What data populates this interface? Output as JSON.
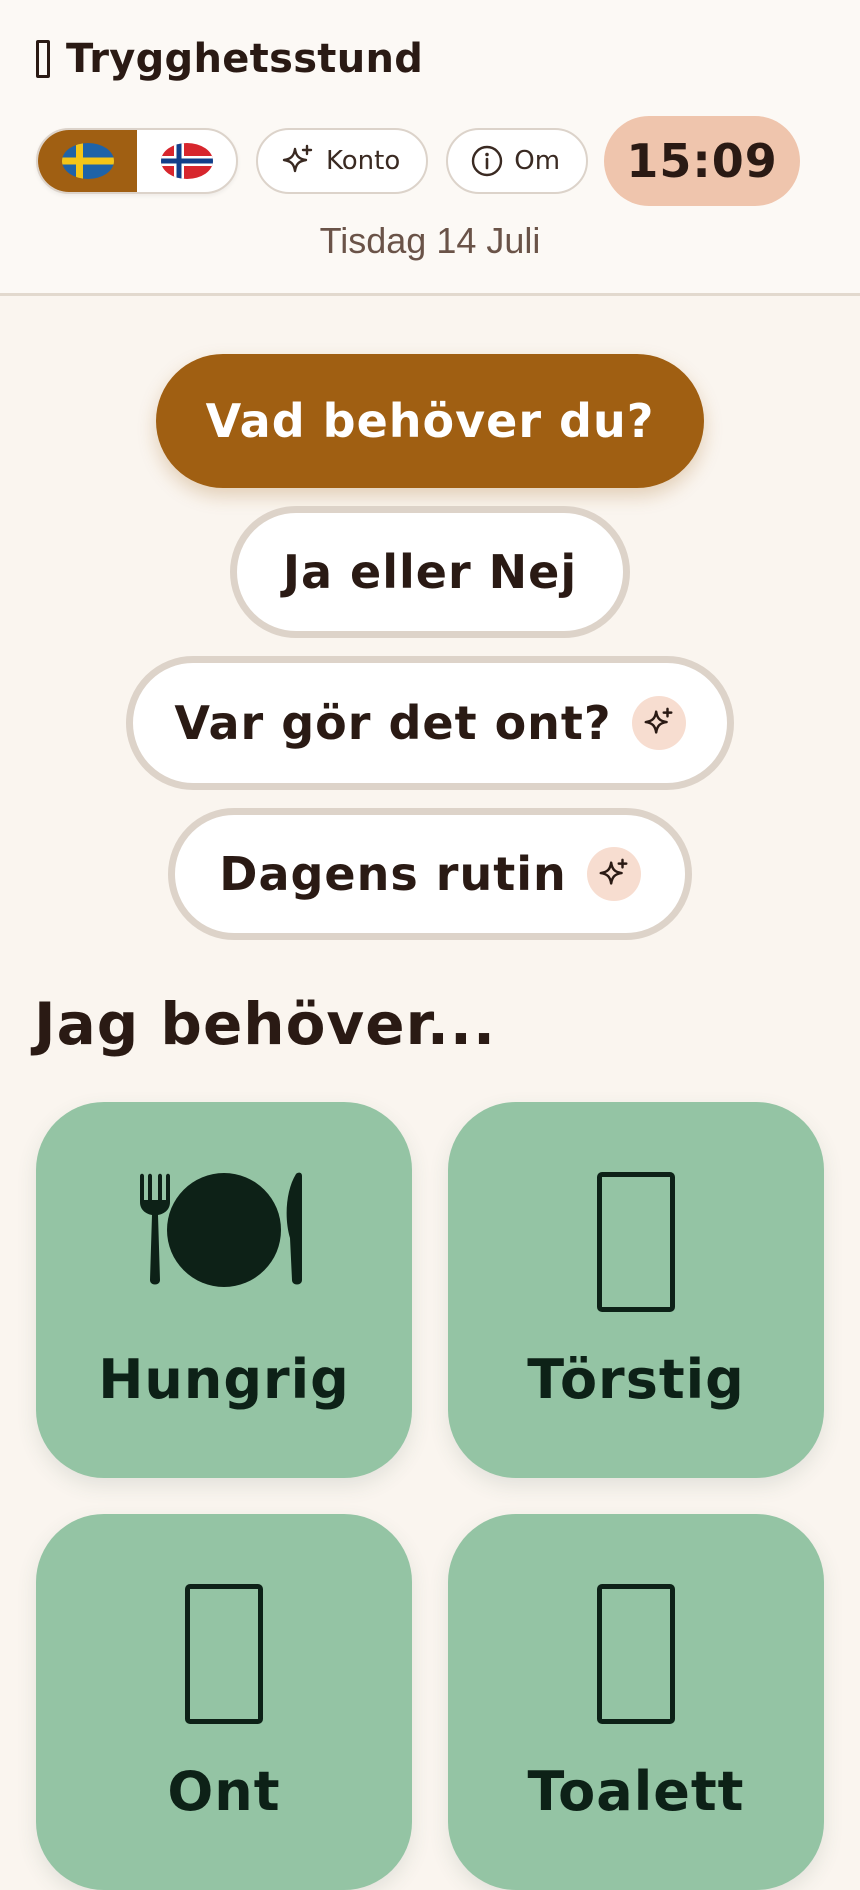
{
  "header": {
    "app_title": "Trygghetsstund",
    "languages": [
      {
        "code": "sv",
        "label": "Svenska",
        "active": true
      },
      {
        "code": "no",
        "label": "Norsk",
        "active": false
      }
    ],
    "account_label": "Konto",
    "about_label": "Om",
    "time": "15:09",
    "date": "Tisdag 14 Juli"
  },
  "main": {
    "primary_button": "Vad behöver du?",
    "buttons": [
      {
        "label": "Ja eller Nej",
        "icon": null
      },
      {
        "label": "Var gör det ont?",
        "icon": "sparkle-icon"
      },
      {
        "label": "Dagens rutin",
        "icon": "sparkle-icon"
      }
    ],
    "section_title": "Jag behöver...",
    "tiles": [
      {
        "label": "Hungrig",
        "icon": "plate-cutlery-icon"
      },
      {
        "label": "Törstig",
        "icon": "drink-icon"
      },
      {
        "label": "Ont",
        "icon": "pain-icon"
      },
      {
        "label": "Toalett",
        "icon": "toilet-icon"
      }
    ]
  },
  "colors": {
    "accent": "#a05f12",
    "tile": "#94c4a4",
    "time_badge": "#efc5ad",
    "background": "#faf5ef"
  }
}
